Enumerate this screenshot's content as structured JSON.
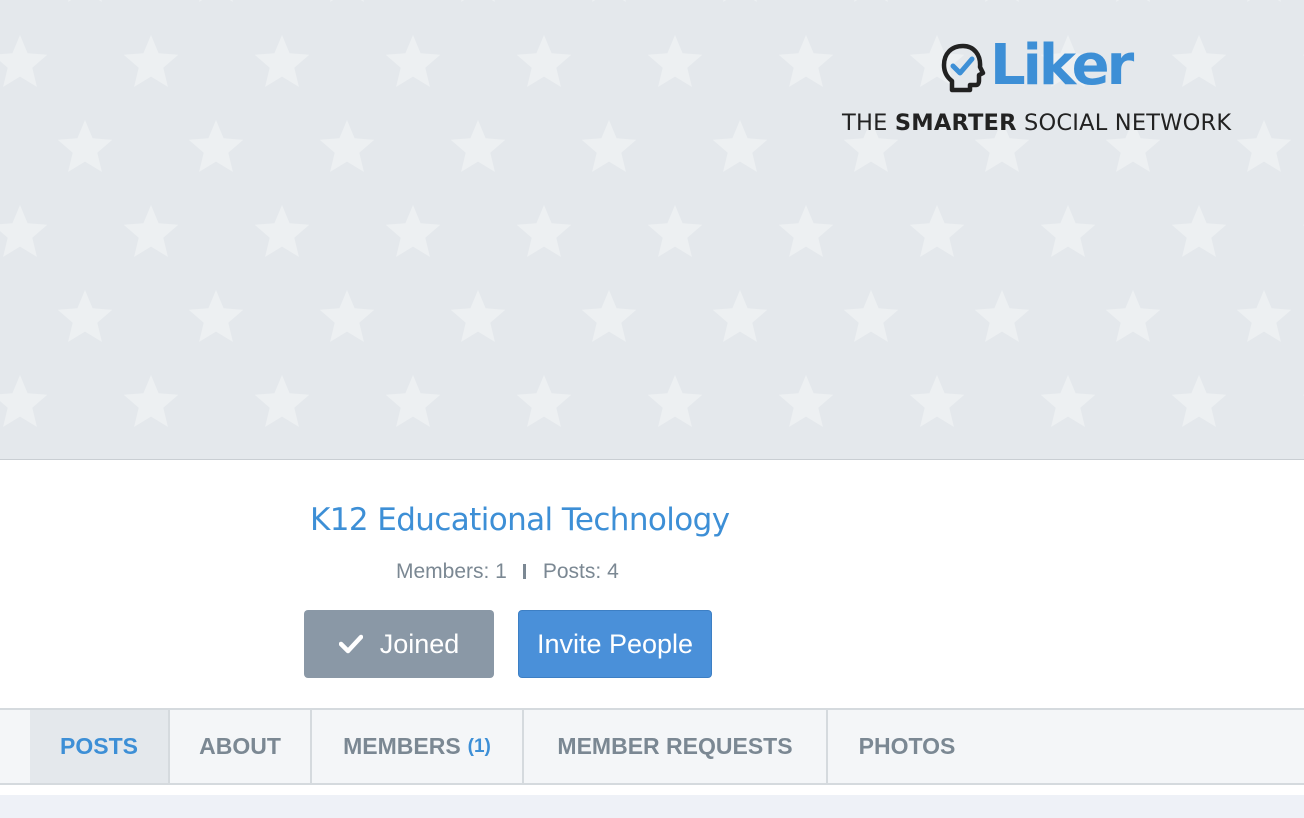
{
  "brand": {
    "logo_text": "Liker",
    "tagline_pre": "THE ",
    "tagline_bold": "SMARTER",
    "tagline_post": " SOCIAL NETWORK",
    "color": "#3d8fd6"
  },
  "group": {
    "title": "K12 Educational Technology",
    "members_label": "Members: 1",
    "posts_label": "Posts: 4"
  },
  "actions": {
    "joined_label": "Joined",
    "invite_label": "Invite People"
  },
  "tabs": [
    {
      "label": "POSTS",
      "active": true
    },
    {
      "label": "ABOUT"
    },
    {
      "label": "MEMBERS",
      "count": "(1)"
    },
    {
      "label": "MEMBER REQUESTS"
    },
    {
      "label": "PHOTOS"
    }
  ],
  "colors": {
    "accent": "#3d8fd6",
    "joined_button": "#8a98a6",
    "invite_button": "#4a90d9",
    "cover_background": "#e4e8ec"
  },
  "icons": {
    "logo": "head-check-icon",
    "joined": "check-icon"
  }
}
